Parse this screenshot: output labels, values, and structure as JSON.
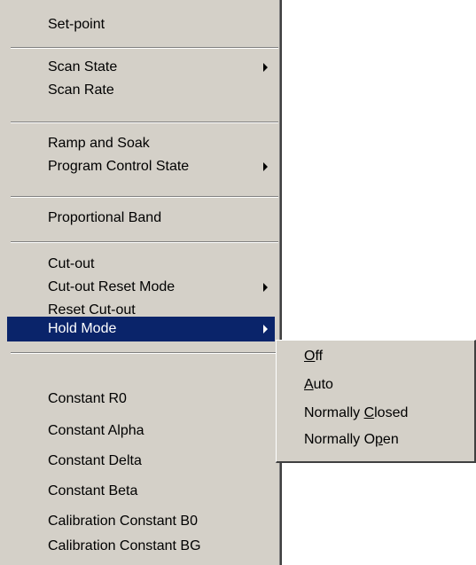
{
  "menu": {
    "items": [
      {
        "label": "Set-point",
        "submenu": false
      },
      {
        "label": "Scan State",
        "submenu": true
      },
      {
        "label": "Scan Rate",
        "submenu": false
      },
      {
        "label": "Ramp and Soak",
        "submenu": false
      },
      {
        "label": "Program Control State",
        "submenu": true
      },
      {
        "label": "Proportional Band",
        "submenu": false
      },
      {
        "label": "Cut-out",
        "submenu": false
      },
      {
        "label": "Cut-out Reset Mode",
        "submenu": true
      },
      {
        "label": "Reset Cut-out",
        "submenu": false
      },
      {
        "label": "Hold Mode",
        "submenu": true,
        "selected": true
      },
      {
        "label": "Constant R0",
        "submenu": false
      },
      {
        "label": "Constant Alpha",
        "submenu": false
      },
      {
        "label": "Constant Delta",
        "submenu": false
      },
      {
        "label": "Constant Beta",
        "submenu": false
      },
      {
        "label": "Calibration Constant B0",
        "submenu": false
      },
      {
        "label": "Calibration Constant BG",
        "submenu": false
      }
    ]
  },
  "submenu": {
    "items": [
      {
        "label": "Off",
        "access_key": "O"
      },
      {
        "label": "Auto",
        "access_key": "A"
      },
      {
        "label": "Normally Closed",
        "access_key": "C"
      },
      {
        "label": "Normally Open",
        "access_key": "p"
      }
    ]
  },
  "colors": {
    "menu_background": "#d4d0c8",
    "highlight_background": "#0a246a",
    "highlight_text": "#ffffff",
    "text": "#000000"
  }
}
